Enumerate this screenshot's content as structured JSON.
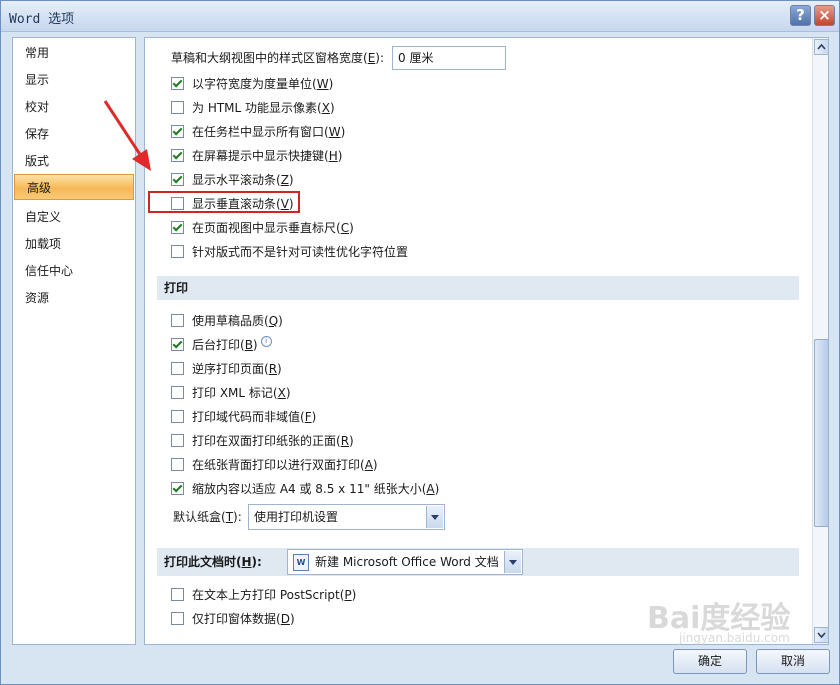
{
  "window": {
    "title": "Word 选项"
  },
  "titlebar": {
    "help_label": "?",
    "close_label": "×"
  },
  "sidebar": {
    "items": [
      {
        "label": "常用"
      },
      {
        "label": "显示"
      },
      {
        "label": "校对"
      },
      {
        "label": "保存"
      },
      {
        "label": "版式"
      },
      {
        "label": "高级",
        "active": true
      },
      {
        "label": "自定义"
      },
      {
        "label": "加载项"
      },
      {
        "label": "信任中心"
      },
      {
        "label": "资源"
      }
    ]
  },
  "display": {
    "style_area_label": "草稿和大纲视图中的样式区窗格宽度(",
    "style_area_key": "E",
    "style_area_suffix": "):",
    "style_area_value": "0 厘米",
    "options": [
      {
        "prefix": "以字符宽度为度量单位(",
        "key": "W",
        "suffix": ")",
        "checked": true
      },
      {
        "prefix": "为 HTML 功能显示像素(",
        "key": "X",
        "suffix": ")",
        "checked": false
      },
      {
        "prefix": "在任务栏中显示所有窗口(",
        "key": "W",
        "suffix": ")",
        "checked": true
      },
      {
        "prefix": "在屏幕提示中显示快捷键(",
        "key": "H",
        "suffix": ")",
        "checked": true
      },
      {
        "prefix": "显示水平滚动条(",
        "key": "Z",
        "suffix": ")",
        "checked": true
      },
      {
        "prefix": "显示垂直滚动条(",
        "key": "V",
        "suffix": ")",
        "checked": false
      },
      {
        "prefix": "在页面视图中显示垂直标尺(",
        "key": "C",
        "suffix": ")",
        "checked": true
      },
      {
        "prefix": "针对版式而不是针对可读性优化字符位置",
        "key": "",
        "suffix": "",
        "checked": false
      }
    ]
  },
  "print": {
    "header": "打印",
    "options": [
      {
        "prefix": "使用草稿品质(",
        "key": "Q",
        "suffix": ")",
        "checked": false
      },
      {
        "prefix": "后台打印(",
        "key": "B",
        "suffix": ")",
        "checked": true
      },
      {
        "prefix": "逆序打印页面(",
        "key": "R",
        "suffix": ")",
        "checked": false
      },
      {
        "prefix": "打印 XML 标记(",
        "key": "X",
        "suffix": ")",
        "checked": false
      },
      {
        "prefix": "打印域代码而非域值(",
        "key": "F",
        "suffix": ")",
        "checked": false
      },
      {
        "prefix": "打印在双面打印纸张的正面(",
        "key": "R",
        "suffix": ")",
        "checked": false
      },
      {
        "prefix": "在纸张背面打印以进行双面打印(",
        "key": "A",
        "suffix": ")",
        "checked": false
      },
      {
        "prefix": "缩放内容以适应 A4 或 8.5 x 11\" 纸张大小(",
        "key": "A",
        "suffix": ")",
        "checked": true
      }
    ],
    "tray_label_prefix": "默认纸盒(",
    "tray_label_key": "T",
    "tray_label_suffix": "):",
    "tray_value": "使用打印机设置",
    "info_icon": "i"
  },
  "print_doc": {
    "header_prefix": "打印此文档时(",
    "header_key": "H",
    "header_suffix": "):",
    "doc_value": "新建 Microsoft Office Word 文档",
    "doc_icon": "W",
    "options": [
      {
        "prefix": "在文本上方打印 PostScript(",
        "key": "P",
        "suffix": ")",
        "checked": false
      },
      {
        "prefix": "仅打印窗体数据(",
        "key": "D",
        "suffix": ")",
        "checked": false
      }
    ]
  },
  "footer": {
    "ok_label": "确定",
    "cancel_label": "取消"
  },
  "watermark": {
    "text": "Bai度经验",
    "sub": "jingyan.baidu.com"
  }
}
